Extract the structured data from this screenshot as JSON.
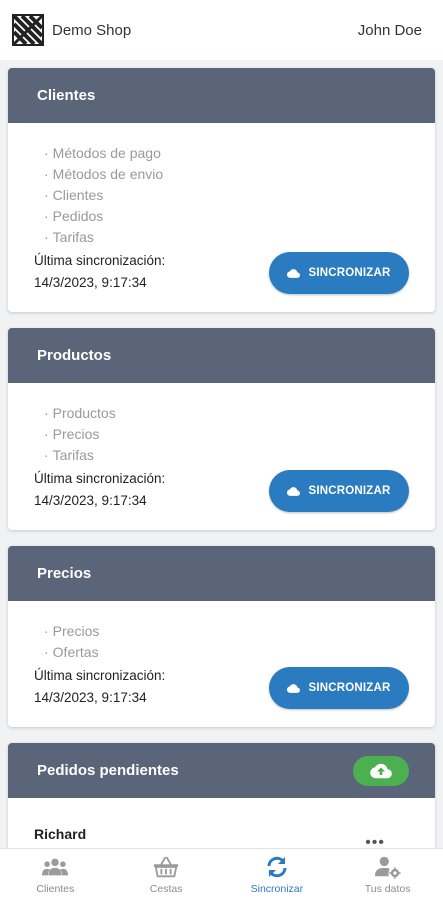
{
  "header": {
    "brand": "Demo Shop",
    "user": "John Doe"
  },
  "colors": {
    "card_header": "#5a6579",
    "primary": "#2b7bc0",
    "success": "#4caf50"
  },
  "sections": [
    {
      "title": "Clientes",
      "items": [
        "Métodos de pago",
        "Métodos de envio",
        "Clientes",
        "Pedidos",
        "Tarifas"
      ],
      "last_sync_label": "Última sincronización:",
      "last_sync_value": "14/3/2023, 9:17:34",
      "button_label": "SINCRONIZAR",
      "button_icon": "cloud-icon"
    },
    {
      "title": "Productos",
      "items": [
        "Productos",
        "Precios",
        "Tarifas"
      ],
      "last_sync_label": "Última sincronización:",
      "last_sync_value": "14/3/2023, 9:17:34",
      "button_label": "SINCRONIZAR",
      "button_icon": "cloud-icon"
    },
    {
      "title": "Precios",
      "items": [
        "Precios",
        "Ofertas"
      ],
      "last_sync_label": "Última sincronización:",
      "last_sync_value": "14/3/2023, 9:17:34",
      "button_label": "SINCRONIZAR",
      "button_icon": "cloud-icon"
    }
  ],
  "pending": {
    "title": "Pedidos pendientes",
    "upload_icon": "cloud-upload-icon",
    "orders": [
      {
        "name": "Richard"
      }
    ]
  },
  "nav": [
    {
      "label": "Clientes",
      "icon": "users-icon",
      "active": false
    },
    {
      "label": "Cestas",
      "icon": "basket-icon",
      "active": false
    },
    {
      "label": "Sincronizar",
      "icon": "sync-icon",
      "active": true
    },
    {
      "label": "Tus datos",
      "icon": "user-settings-icon",
      "active": false
    }
  ]
}
